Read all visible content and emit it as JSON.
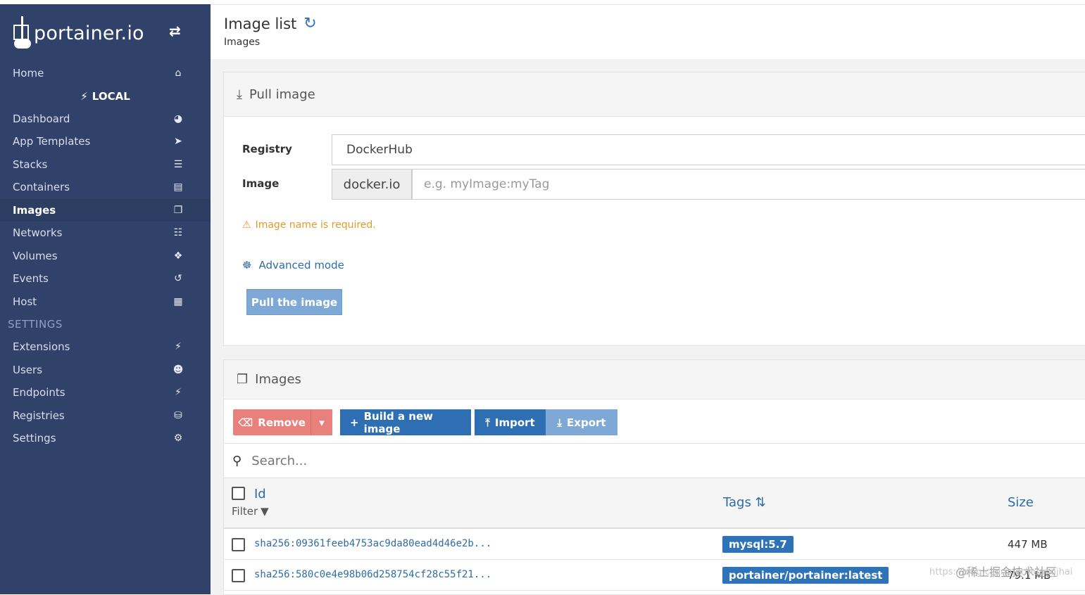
{
  "brand": {
    "name": "portainer.io",
    "toggle_icon": "exchange-icon"
  },
  "sidebar": {
    "home": {
      "label": "Home",
      "icon": "home-icon"
    },
    "local": {
      "label": "LOCAL",
      "icon": "plug-icon"
    },
    "items": [
      {
        "label": "Dashboard",
        "icon": "tachometer-icon"
      },
      {
        "label": "App Templates",
        "icon": "rocket-icon"
      },
      {
        "label": "Stacks",
        "icon": "th-list-icon"
      },
      {
        "label": "Containers",
        "icon": "server-icon"
      },
      {
        "label": "Images",
        "icon": "clone-icon",
        "active": true
      },
      {
        "label": "Networks",
        "icon": "sitemap-icon"
      },
      {
        "label": "Volumes",
        "icon": "cubes-icon"
      },
      {
        "label": "Events",
        "icon": "history-icon"
      },
      {
        "label": "Host",
        "icon": "th-icon"
      }
    ],
    "settings_heading": "SETTINGS",
    "settings_items": [
      {
        "label": "Extensions",
        "icon": "bolt-icon"
      },
      {
        "label": "Users",
        "icon": "users-icon"
      },
      {
        "label": "Endpoints",
        "icon": "plug-icon"
      },
      {
        "label": "Registries",
        "icon": "database-icon"
      },
      {
        "label": "Settings",
        "icon": "cogs-icon"
      }
    ]
  },
  "header": {
    "title": "Image list",
    "subtitle": "Images"
  },
  "pull": {
    "title": "Pull image",
    "registry_label": "Registry",
    "registry_value": "DockerHub",
    "image_label": "Image",
    "image_prefix": "docker.io",
    "image_placeholder": "e.g. myImage:myTag",
    "warning": "Image name is required.",
    "advanced": "Advanced mode",
    "button": "Pull the image"
  },
  "images": {
    "title": "Images",
    "remove": "Remove",
    "build": "Build a new image",
    "import": "Import",
    "export": "Export",
    "search_placeholder": "Search...",
    "columns": {
      "id": "Id",
      "filter": "Filter",
      "tags": "Tags",
      "size": "Size"
    },
    "rows": [
      {
        "id": "sha256:09361feeb4753ac9da80ead4d46e2b...",
        "tag": "mysql:5.7",
        "size": "447 MB"
      },
      {
        "id": "sha256:580c0e4e98b06d258754cf28c55f21...",
        "tag": "portainer/portainer:latest",
        "size": "79.1 MB"
      }
    ]
  },
  "watermark": {
    "line1": "@稀土掘金技术社区",
    "line2": "https://blog.csdn.net/huangjhai"
  },
  "colors": {
    "sidebar": "#30426a",
    "primary": "#2e72b8",
    "danger": "#e8807c",
    "warning": "#e39a2d",
    "disabled": "#7ea9d6"
  }
}
